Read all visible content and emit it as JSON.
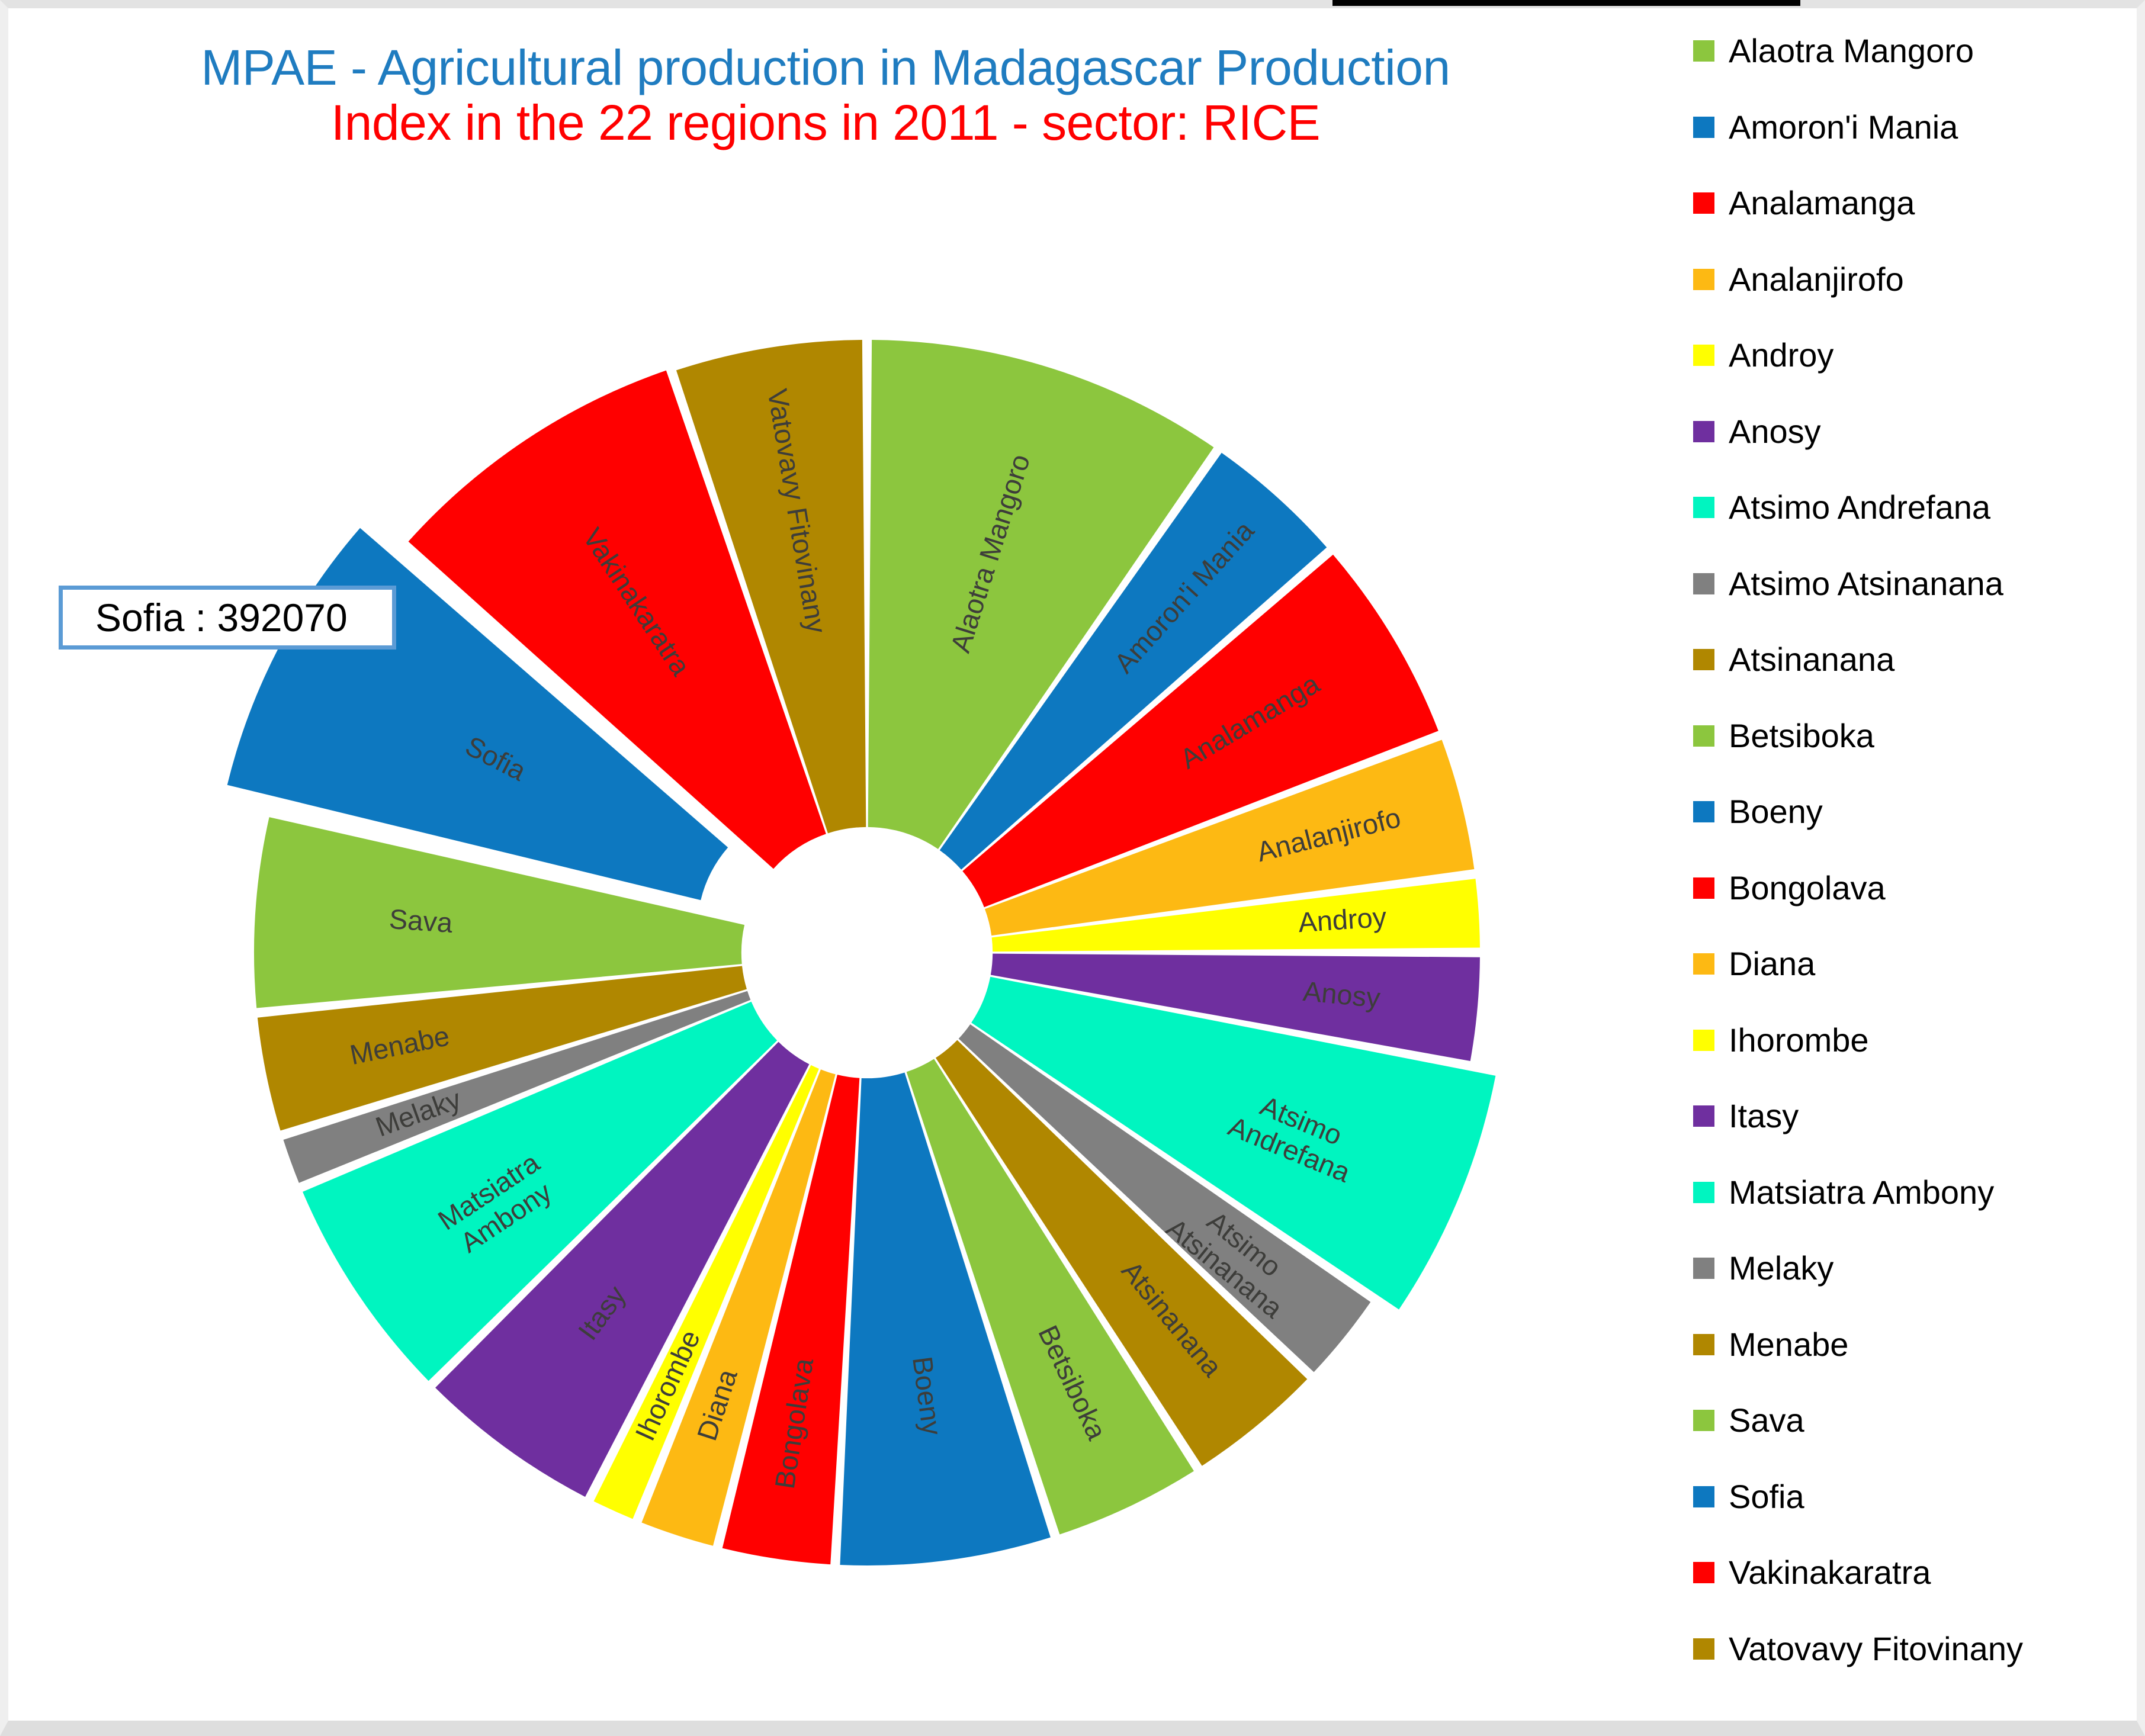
{
  "window": {
    "background_color": "#ffffff",
    "frame_color": "#e3e3e3"
  },
  "title": {
    "line1": "MPAE - Agricultural production in Madagascar Production",
    "line2": "Index in the 22 regions in 2011 - sector: RICE",
    "line1_color": "#1f7cc0",
    "line2_color": "#ff0000"
  },
  "tooltip": {
    "text": "Sofia : 392070",
    "region": "Sofia",
    "value": 392070,
    "border_color": "#5b9bd5",
    "background_color": "#ffffff"
  },
  "legend": {
    "position": "right",
    "items": [
      {
        "label": "Alaotra Mangoro",
        "color": "#8cc63e"
      },
      {
        "label": "Amoron'i Mania",
        "color": "#0d78c0"
      },
      {
        "label": "Analamanga",
        "color": "#ff0000"
      },
      {
        "label": "Analanjirofo",
        "color": "#fdb913"
      },
      {
        "label": "Androy",
        "color": "#ffff00"
      },
      {
        "label": "Anosy",
        "color": "#6f2f9f"
      },
      {
        "label": "Atsimo Andrefana",
        "color": "#00f5c0"
      },
      {
        "label": "Atsimo Atsinanana",
        "color": "#808080"
      },
      {
        "label": "Atsinanana",
        "color": "#b08700"
      },
      {
        "label": "Betsiboka",
        "color": "#8cc63e"
      },
      {
        "label": "Boeny",
        "color": "#0d78c0"
      },
      {
        "label": "Bongolava",
        "color": "#ff0000"
      },
      {
        "label": "Diana",
        "color": "#fdb913"
      },
      {
        "label": "Ihorombe",
        "color": "#ffff00"
      },
      {
        "label": "Itasy",
        "color": "#6f2f9f"
      },
      {
        "label": "Matsiatra Ambony",
        "color": "#00f5c0"
      },
      {
        "label": "Melaky",
        "color": "#808080"
      },
      {
        "label": "Menabe",
        "color": "#b08700"
      },
      {
        "label": "Sava",
        "color": "#8cc63e"
      },
      {
        "label": "Sofia",
        "color": "#0d78c0"
      },
      {
        "label": "Vakinakaratra",
        "color": "#ff0000"
      },
      {
        "label": "Vatovavy Fitovinany",
        "color": "#b08700"
      }
    ]
  },
  "chart_data": {
    "type": "pie",
    "variant": "doughnut",
    "title": "MPAE - Agricultural production in Madagascar Production Index in the 22 regions in 2011 - sector: RICE",
    "start_angle_deg": 0,
    "direction": "clockwise",
    "inner_radius_ratio": 0.205,
    "outer_radius_ratio": 1.0,
    "exploded_slice": "Sofia",
    "highlighted_slice": "Sofia",
    "legend_position": "right",
    "grid": false,
    "labels_shown_on_slices": true,
    "label_color": "#3d3d3a",
    "slice_gap_deg": 0.9,
    "categories": [
      "Alaotra Mangoro",
      "Amoron'i Mania",
      "Analamanga",
      "Analanjirofo",
      "Androy",
      "Anosy",
      "Atsimo Andrefana",
      "Atsimo Atsinanana",
      "Atsinanana",
      "Betsiboka",
      "Boeny",
      "Bongolava",
      "Diana",
      "Ihorombe",
      "Itasy",
      "Matsiatra Ambony",
      "Melaky",
      "Menabe",
      "Sava",
      "Sofia",
      "Vakinakaratra",
      "Vatovavy Fitovinany"
    ],
    "values": [
      486000,
      197000,
      281000,
      186000,
      102000,
      148000,
      330000,
      130000,
      190000,
      206000,
      290000,
      155000,
      110000,
      68000,
      255000,
      310000,
      72000,
      163000,
      263000,
      392070,
      417000,
      258000
    ],
    "share_deg": [
      37.0,
      15.0,
      21.4,
      14.2,
      7.8,
      11.3,
      25.1,
      9.9,
      14.5,
      15.7,
      22.1,
      11.8,
      8.4,
      5.2,
      19.4,
      23.6,
      5.5,
      12.4,
      20.0,
      29.9,
      31.8,
      19.7
    ],
    "colors": [
      "#8cc63e",
      "#0d78c0",
      "#ff0000",
      "#fdb913",
      "#ffff00",
      "#6f2f9f",
      "#00f5c0",
      "#808080",
      "#b08700",
      "#8cc63e",
      "#0d78c0",
      "#ff0000",
      "#fdb913",
      "#ffff00",
      "#6f2f9f",
      "#00f5c0",
      "#808080",
      "#b08700",
      "#8cc63e",
      "#0d78c0",
      "#ff0000",
      "#b08700"
    ],
    "slice_labels": [
      [
        "Alaotra Mangoro"
      ],
      [
        "Amoron'i Mania"
      ],
      [
        "Analamanga"
      ],
      [
        "Analanjirofo"
      ],
      [
        "Androy"
      ],
      [
        "Anosy"
      ],
      [
        "Atsimo",
        "Andrefana"
      ],
      [
        "Atsimo",
        "Atsinanana"
      ],
      [
        "Atsinanana"
      ],
      [
        "Betsiboka"
      ],
      [
        "Boeny"
      ],
      [
        "Bongolava"
      ],
      [
        "Diana"
      ],
      [
        "Ihorombe"
      ],
      [
        "Itasy"
      ],
      [
        "Matsiatra",
        "Ambony"
      ],
      [
        "Melaky"
      ],
      [
        "Menabe"
      ],
      [
        "Sava"
      ],
      [
        "Sofia"
      ],
      [
        "Vakinakaratra"
      ],
      [
        "Vatovavy Fitovinany"
      ]
    ]
  }
}
